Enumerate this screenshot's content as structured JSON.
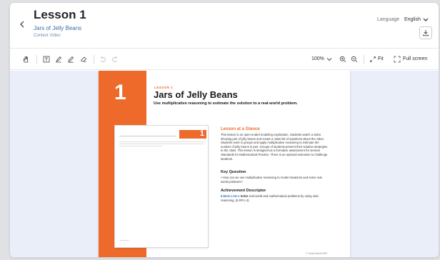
{
  "header": {
    "back_icon": "chevron-left-icon",
    "title": "Lesson 1",
    "subtitle": "Jars of Jelly Beans",
    "sub_subtitle": "Context Video",
    "language_label": "Language",
    "language_value": "English",
    "download_icon": "download-icon"
  },
  "toolbar": {
    "tools": [
      "hand-icon",
      "text-box-icon",
      "highlighter-icon",
      "pen-icon",
      "eraser-icon",
      "undo-icon",
      "redo-icon"
    ],
    "zoom_level": "100%",
    "fit_label": "Fit",
    "full_screen_label": "Full screen"
  },
  "document": {
    "lesson_number": "1",
    "kicker": "LESSON 1",
    "title": "Jars of Jelly Beans",
    "subtitle": "Use multiplicative reasoning to estimate the solution to a real-world problem.",
    "glance_heading": "Lesson at a Glance",
    "glance_text": "This lesson is an open-ended modeling exploration. Students watch a video showing jars of jelly beans and create a class list of questions about the video. Students work in groups and apply multiplicative reasoning to estimate the number of jelly beans in jars. Groups of students present their solution strategies to the class. This lesson is designed as a formative assessment for several Standards for Mathematical Practice. There is an optional extension to challenge students.",
    "key_question_heading": "Key Question",
    "key_question_text": "• How can we use multiplicative reasoning to model situations and solve real-world problems?",
    "descriptor_heading": "Achievement Descriptor",
    "descriptor_code": "6.Mod.1.AD.1",
    "descriptor_bold": "Solve",
    "descriptor_text": "real-world and mathematical problems by using ratio reasoning. (6.RP.A.3)",
    "thumb_number": "1",
    "footer": "© Great Minds PBC"
  },
  "colors": {
    "accent": "#ee6a2b",
    "link": "#3a6ea5"
  }
}
